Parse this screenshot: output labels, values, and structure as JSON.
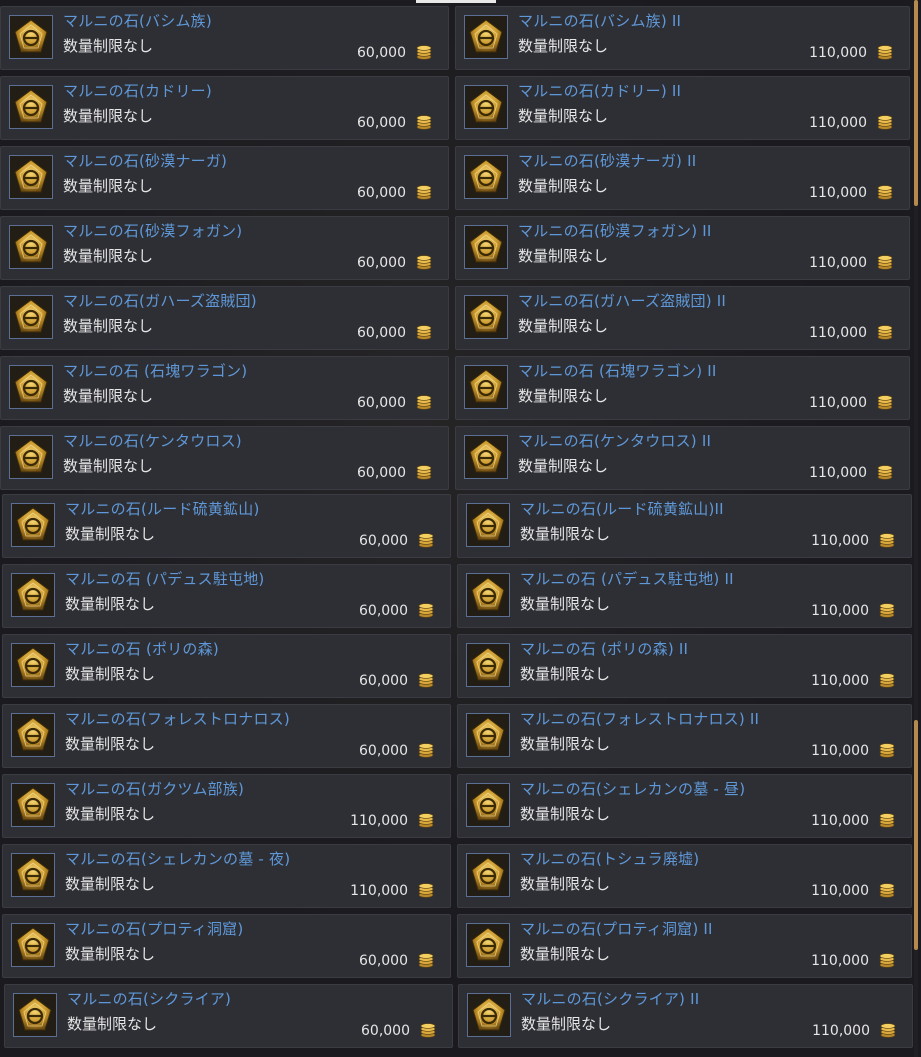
{
  "common": {
    "limit_label": "数量制限なし",
    "item_icon": "marni-stone-icon",
    "currency_icon": "silver-coin-stack-icon"
  },
  "rows": [
    {
      "left": {
        "name": "マルニの石(バシム族)",
        "price": "60,000"
      },
      "right": {
        "name": "マルニの石(バシム族) II",
        "price": "110,000"
      }
    },
    {
      "left": {
        "name": "マルニの石(カドリー)",
        "price": "60,000"
      },
      "right": {
        "name": "マルニの石(カドリー) II",
        "price": "110,000"
      }
    },
    {
      "left": {
        "name": "マルニの石(砂漠ナーガ)",
        "price": "60,000"
      },
      "right": {
        "name": "マルニの石(砂漠ナーガ) II",
        "price": "110,000"
      }
    },
    {
      "left": {
        "name": "マルニの石(砂漠フォガン)",
        "price": "60,000"
      },
      "right": {
        "name": "マルニの石(砂漠フォガン) II",
        "price": "110,000"
      }
    },
    {
      "left": {
        "name": "マルニの石(ガハーズ盗賊団)",
        "price": "60,000"
      },
      "right": {
        "name": "マルニの石(ガハーズ盗賊団) II",
        "price": "110,000"
      }
    },
    {
      "left": {
        "name": "マルニの石 (石塊ワラゴン)",
        "price": "60,000"
      },
      "right": {
        "name": "マルニの石 (石塊ワラゴン) II",
        "price": "110,000"
      }
    },
    {
      "left": {
        "name": "マルニの石(ケンタウロス)",
        "price": "60,000"
      },
      "right": {
        "name": "マルニの石(ケンタウロス) II",
        "price": "110,000"
      }
    },
    {
      "left": {
        "name": "マルニの石(ルード硫黄鉱山)",
        "price": "60,000"
      },
      "right": {
        "name": "マルニの石(ルード硫黄鉱山)II",
        "price": "110,000"
      }
    },
    {
      "left": {
        "name": "マルニの石 (パデュス駐屯地)",
        "price": "60,000"
      },
      "right": {
        "name": "マルニの石 (パデュス駐屯地) II",
        "price": "110,000"
      }
    },
    {
      "left": {
        "name": "マルニの石 (ポリの森)",
        "price": "60,000"
      },
      "right": {
        "name": "マルニの石 (ポリの森) II",
        "price": "110,000"
      }
    },
    {
      "left": {
        "name": "マルニの石(フォレストロナロス)",
        "price": "60,000"
      },
      "right": {
        "name": "マルニの石(フォレストロナロス) II",
        "price": "110,000"
      }
    },
    {
      "left": {
        "name": "マルニの石(ガクツム部族)",
        "price": "110,000"
      },
      "right": {
        "name": "マルニの石(シェレカンの墓 - 昼)",
        "price": "110,000"
      }
    },
    {
      "left": {
        "name": "マルニの石(シェレカンの墓 - 夜)",
        "price": "110,000"
      },
      "right": {
        "name": "マルニの石(トシュラ廃墟)",
        "price": "110,000"
      }
    },
    {
      "left": {
        "name": "マルニの石(プロティ洞窟)",
        "price": "60,000"
      },
      "right": {
        "name": "マルニの石(プロティ洞窟) II",
        "price": "110,000"
      }
    },
    {
      "left": {
        "name": "マルニの石(シクライア)",
        "price": "60,000"
      },
      "right": {
        "name": "マルニの石(シクライア) II",
        "price": "110,000"
      }
    }
  ]
}
